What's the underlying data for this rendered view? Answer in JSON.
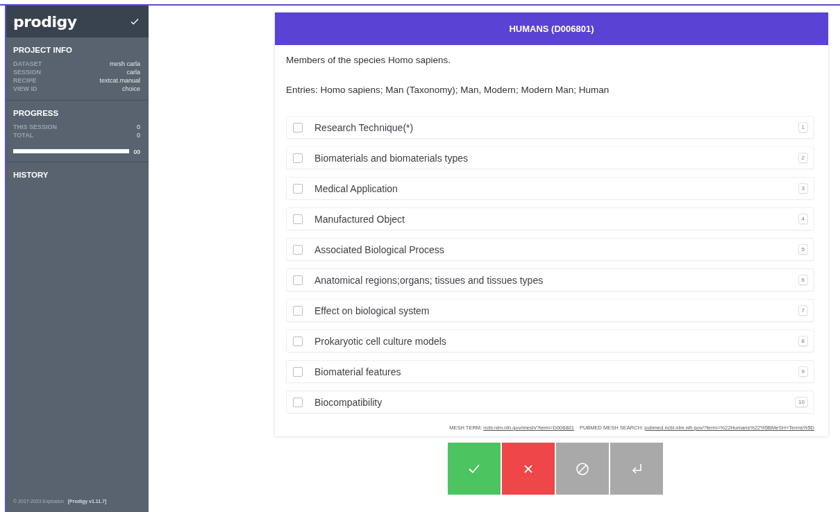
{
  "sidebar": {
    "logo": "prodigy",
    "project_info": {
      "title": "PROJECT INFO",
      "rows": [
        {
          "label": "DATASET",
          "value": "mesh carla"
        },
        {
          "label": "SESSION",
          "value": "carla"
        },
        {
          "label": "RECIPE",
          "value": "textcat.manual"
        },
        {
          "label": "VIEW ID",
          "value": "choice"
        }
      ]
    },
    "progress": {
      "title": "PROGRESS",
      "rows": [
        {
          "label": "THIS SESSION",
          "value": "0"
        },
        {
          "label": "TOTAL",
          "value": "0"
        }
      ],
      "level": 1,
      "reading": "∞"
    },
    "history": {
      "title": "HISTORY"
    },
    "footer": {
      "copyright": "© 2017-2023 Explosion",
      "version": "[Prodigy v1.11.7]"
    }
  },
  "card": {
    "title": "HUMANS (D006801)",
    "description": "Members of the species Homo sapiens.",
    "entries": "Entries: Homo sapiens; Man (Taxonomy); Man, Modern; Modern Man; Human",
    "options": [
      {
        "label": "Research Technique(*)",
        "key": "1",
        "checked": false
      },
      {
        "label": "Biomaterials and biomaterials types",
        "key": "2",
        "checked": false
      },
      {
        "label": "Medical Application",
        "key": "3",
        "checked": false
      },
      {
        "label": "Manufactured Object",
        "key": "4",
        "checked": false
      },
      {
        "label": "Associated Biological Process",
        "key": "5",
        "checked": false
      },
      {
        "label": "Anatomical regions;organs; tissues and tissues types",
        "key": "6",
        "checked": false
      },
      {
        "label": "Effect on biological system",
        "key": "7",
        "checked": false
      },
      {
        "label": "Prokaryotic cell culture models",
        "key": "8",
        "checked": false
      },
      {
        "label": "Biomaterial features",
        "key": "9",
        "checked": false
      },
      {
        "label": "Biocompatibility",
        "key": "10",
        "checked": false
      }
    ],
    "meta": [
      {
        "label": "MESH TERM:",
        "link": "ncbi.nlm.nih.gov/mesh/?term=D006801"
      },
      {
        "label": "PUBMED MESH SEARCH:",
        "link": "pubmed.ncbi.nlm.nih.gov/?term=%22Humans%22%5BMeSH+Terms%5D"
      }
    ]
  },
  "actions": [
    {
      "kind": "accept"
    },
    {
      "kind": "reject"
    },
    {
      "kind": "ignore"
    },
    {
      "kind": "undo"
    }
  ]
}
